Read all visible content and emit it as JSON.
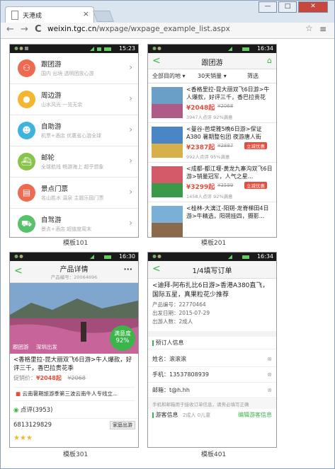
{
  "browser": {
    "tab_title": "天港成",
    "tab_close": "×",
    "url_host": "weixin.tgc.cn",
    "url_path": "/wxpage/wxpage_example_list.aspx",
    "nav_back": "←",
    "nav_forward": "→",
    "nav_reload": "C",
    "star": "☆",
    "menu": "≡",
    "win_minimize": "—",
    "win_maximize": "□",
    "win_close": "✕"
  },
  "panels": {
    "p101": {
      "caption": "模板101",
      "time": "15:23",
      "items": [
        {
          "title": "跟团游",
          "sub": "国内 出境 透明团放心游",
          "icon": "group-icon",
          "color": "#ee6b52",
          "glyph": "⚇"
        },
        {
          "title": "周边游",
          "sub": "山水风光 一览无余",
          "icon": "location-icon",
          "color": "#f4b531",
          "glyph": "●"
        },
        {
          "title": "自助游",
          "sub": "机票+酒店 优惠省心游全球",
          "icon": "robot-icon",
          "color": "#3eb3dd",
          "glyph": "☻"
        },
        {
          "title": "邮轮",
          "sub": "全球航线 畅游海上 超乎想象",
          "icon": "ship-icon",
          "color": "#88c44a",
          "glyph": "⛴"
        },
        {
          "title": "景点门票",
          "sub": "名山胜水 温泉 主题乐园门票",
          "icon": "ticket-icon",
          "color": "#ee6b52",
          "glyph": "▤"
        },
        {
          "title": "自驾游",
          "sub": "景点+酒店 超值度周末",
          "icon": "car-icon",
          "color": "#58c26b",
          "glyph": "⛟"
        }
      ]
    },
    "p201": {
      "caption": "模板201",
      "time": "16:34",
      "title": "跟团游",
      "filters": [
        "全部目的地 ▾",
        "30天销量 ▾",
        "筛选"
      ],
      "items": [
        {
          "title": "<香格里拉-昆大丽双飞6日游>牛人爆款，好评三千，香巴拉贵花",
          "price": "¥2048起",
          "old": "¥2068",
          "meta": "3947人点评   92%满意",
          "badge": ""
        },
        {
          "title": "<曼谷-芭堤雅5晚6日游>保证A380 暑期整包团 夜游唐人街",
          "price": "¥2387起",
          "old": "¥2887",
          "meta": "992人点评   95%满意",
          "badge": "立减优惠"
        },
        {
          "title": "<成都-都江堰-黄龙九寨沟双飞6日游>销量冠军，人气之星...",
          "price": "¥3299起",
          "old": "¥3599",
          "meta": "1458人点评   92%满意",
          "badge": "立减优惠"
        },
        {
          "title": "<桂林-大漓江-阳朔-龙脊梯田4日游>牛精选，阳朔挂四，摄影...",
          "price": "",
          "old": "",
          "meta": "",
          "badge": ""
        }
      ]
    },
    "p301": {
      "caption": "模板301",
      "time": "16:30",
      "title": "产品详情",
      "subtitle": "产品编号：20064696",
      "tags": [
        "跟团游",
        "深圳出发"
      ],
      "satisfaction_label": "满意度",
      "satisfaction": "92%",
      "product_title": "<香格里拉-昆大丽双飞6日游>牛人爆款，好评三千，香巴拉贵花季",
      "promo_label": "促销价：",
      "price": "¥2048起",
      "old_price": "¥2068",
      "notice": "云南暑期旅游季第三波云南牛人专线立...",
      "reviews": "点评(3953)",
      "phone": "6813129829",
      "family": "家庭出游"
    },
    "p401": {
      "caption": "模板401",
      "time": "16:34",
      "title": "1/4填写订单",
      "product": "<迪拜-阿布扎比6日游>香港A380直飞，国际五星，真果粒花少推荐",
      "code": "产品编号：22770464",
      "date": "出发日期：2015-07-29",
      "people": "出游人数：2成人",
      "section": "预订人信息",
      "name_label": "姓名：",
      "name_value": "滚滚滚",
      "phone_label": "手机：",
      "phone_value": "13537808939",
      "email_label": "邮箱：",
      "email_value": "t@h.hh",
      "tip": "手机和邮箱用于接收订单信息，请务必填写正确",
      "traveler": "游客信息",
      "traveler_count": "2成人 0儿童",
      "edit": "编辑游客信息"
    }
  }
}
